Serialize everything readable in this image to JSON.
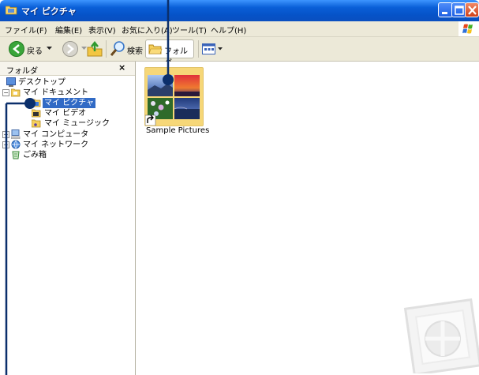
{
  "window": {
    "title": "マイ ピクチャ"
  },
  "menu": [
    {
      "id": "file",
      "label": "ファイル(F)"
    },
    {
      "id": "edit",
      "label": "編集(E)"
    },
    {
      "id": "view",
      "label": "表示(V)"
    },
    {
      "id": "favorites",
      "label": "お気に入り(A)"
    },
    {
      "id": "tools",
      "label": "ツール(T)"
    },
    {
      "id": "help",
      "label": "ヘルプ(H)"
    }
  ],
  "toolbar": {
    "back_label": "戻る",
    "search_label": "検索",
    "folders_label": "フォルダ"
  },
  "folder_pane": {
    "title": "フォルダ",
    "close_glyph": "×",
    "tree": [
      {
        "label": "デスクトップ"
      },
      {
        "label": "マイ ドキュメント",
        "expander": "⊟"
      },
      {
        "label": "マイ ピクチャ",
        "selected": true
      },
      {
        "label": "マイ ビデオ"
      },
      {
        "label": "マイ ミュージック"
      },
      {
        "label": "マイ コンピュータ",
        "expander": "⊞"
      },
      {
        "label": "マイ ネットワーク",
        "expander": "⊞"
      },
      {
        "label": "ごみ箱"
      }
    ]
  },
  "content": {
    "items": [
      {
        "label": "Sample Pictures"
      }
    ]
  },
  "colors": {
    "title_bar": "#0a5fd8",
    "selection": "#316ac5",
    "callout": "#0b2f6b",
    "folder": "#f6d778"
  }
}
